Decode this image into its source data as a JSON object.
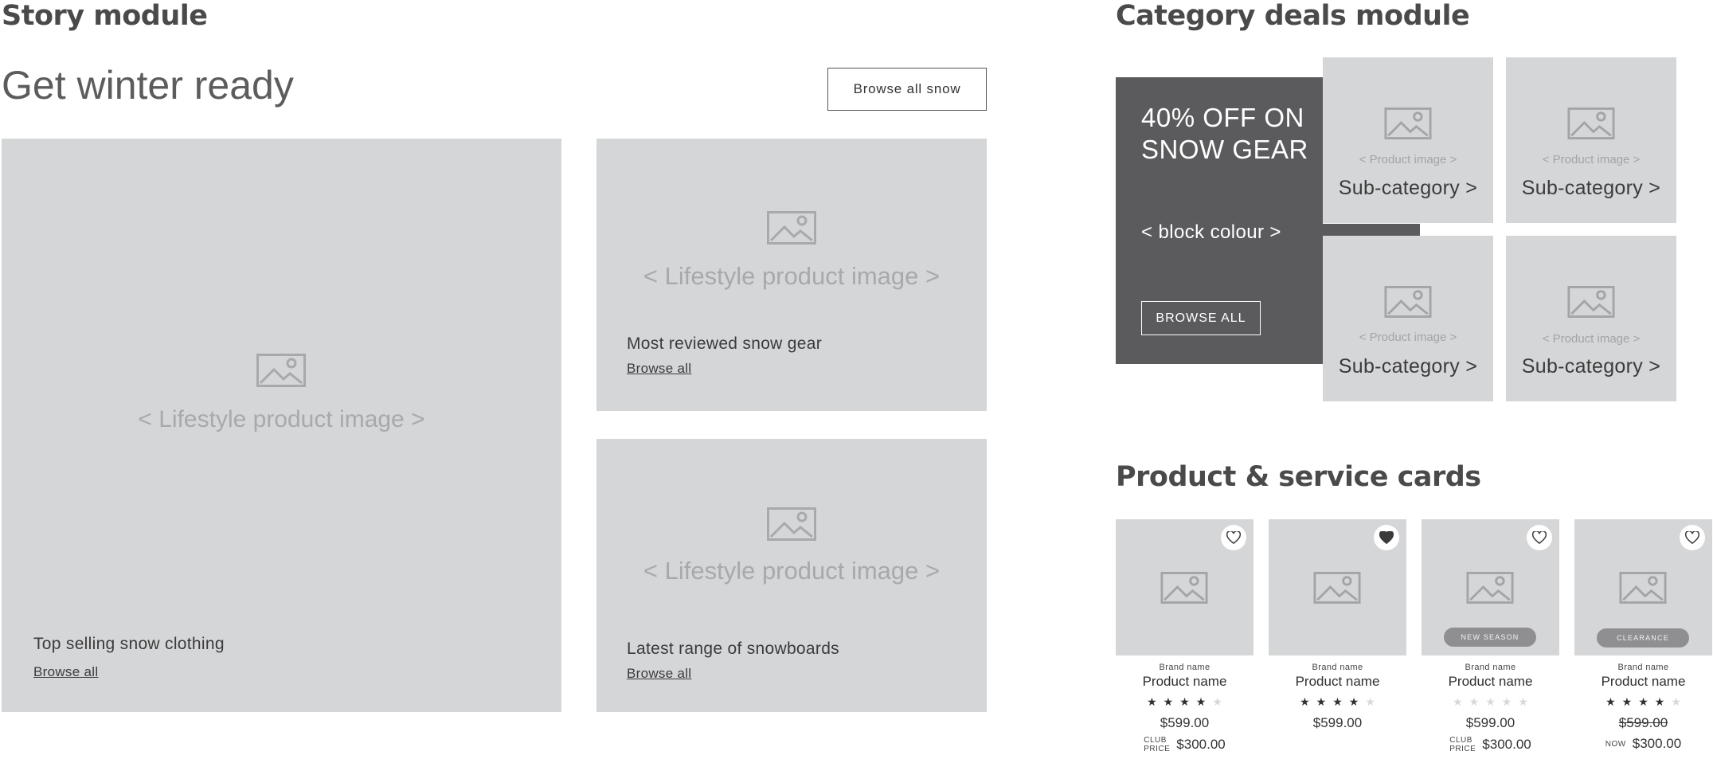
{
  "story": {
    "section_title": "Story module",
    "heading": "Get winter ready",
    "browse_button": "Browse all snow",
    "tiles": [
      {
        "image_label": "< Lifestyle product image >",
        "caption": "Top selling snow clothing",
        "link": "Browse all"
      },
      {
        "image_label": "< Lifestyle product image >",
        "caption": "Most reviewed snow gear",
        "link": "Browse all"
      },
      {
        "image_label": "< Lifestyle product image >",
        "caption": "Latest range of snowboards",
        "link": "Browse all"
      }
    ]
  },
  "category": {
    "section_title": "Category deals module",
    "promo": {
      "title_line1": "40% OFF ON",
      "title_line2": "SNOW GEAR",
      "subtitle": "< block colour >",
      "button": "BROWSE ALL",
      "color": "#5b5b5d"
    },
    "subcategories": [
      {
        "image_label": "< Product image >",
        "label": "Sub-category >"
      },
      {
        "image_label": "< Product image >",
        "label": "Sub-category >"
      },
      {
        "image_label": "< Product image >",
        "label": "Sub-category >"
      },
      {
        "image_label": "< Product image >",
        "label": "Sub-category >"
      }
    ]
  },
  "cards": {
    "section_title": "Product & service cards",
    "items": [
      {
        "brand": "Brand name",
        "name": "Product name",
        "rating": 4,
        "price": "$599.00",
        "club_label_1": "CLUB",
        "club_label_2": "PRICE",
        "club_price": "$300.00",
        "badge": "",
        "favourite": false
      },
      {
        "brand": "Brand name",
        "name": "Product name",
        "rating": 4,
        "price": "$599.00",
        "club_label_1": "",
        "club_label_2": "",
        "club_price": "",
        "badge": "",
        "favourite": true
      },
      {
        "brand": "Brand name",
        "name": "Product name",
        "rating": 0,
        "price": "$599.00",
        "club_label_1": "CLUB",
        "club_label_2": "PRICE",
        "club_price": "$300.00",
        "badge": "NEW SEASON",
        "favourite": false
      },
      {
        "brand": "Brand name",
        "name": "Product name",
        "rating": 4,
        "price": "$599.00",
        "club_label_1": "NOW",
        "club_label_2": "",
        "club_price": "$300.00",
        "badge": "CLEARANCE",
        "favourite": false
      }
    ]
  },
  "colors": {
    "placeholder": "#d5d6d8",
    "placeholder_text": "#a8a9ac",
    "dark": "#5b5b5d"
  }
}
